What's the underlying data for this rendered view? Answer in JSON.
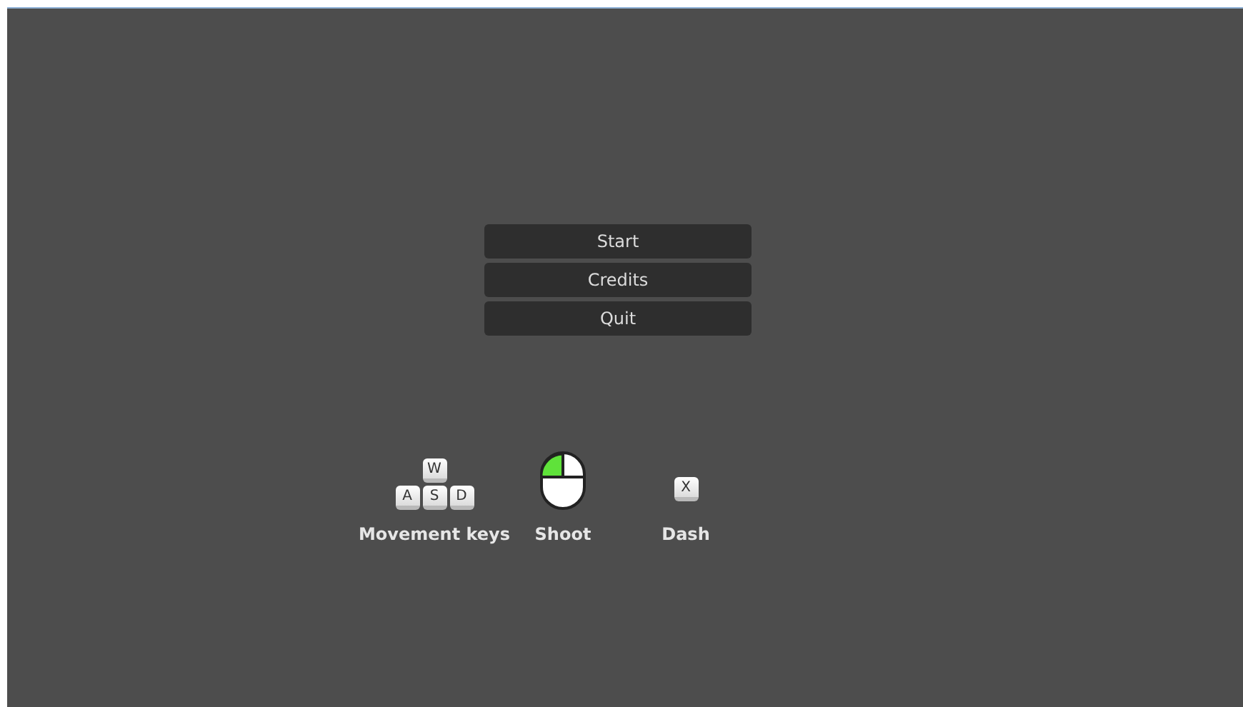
{
  "menu": [
    {
      "label": "Start"
    },
    {
      "label": "Credits"
    },
    {
      "label": "Quit"
    }
  ],
  "controls": [
    {
      "kind": "keys",
      "keys": [
        "W",
        "A",
        "S",
        "D"
      ],
      "label": "Movement keys"
    },
    {
      "kind": "mouse",
      "left_pressed": true,
      "label": "Shoot"
    },
    {
      "kind": "keys",
      "keys": [
        "X"
      ],
      "label": "Dash"
    }
  ]
}
